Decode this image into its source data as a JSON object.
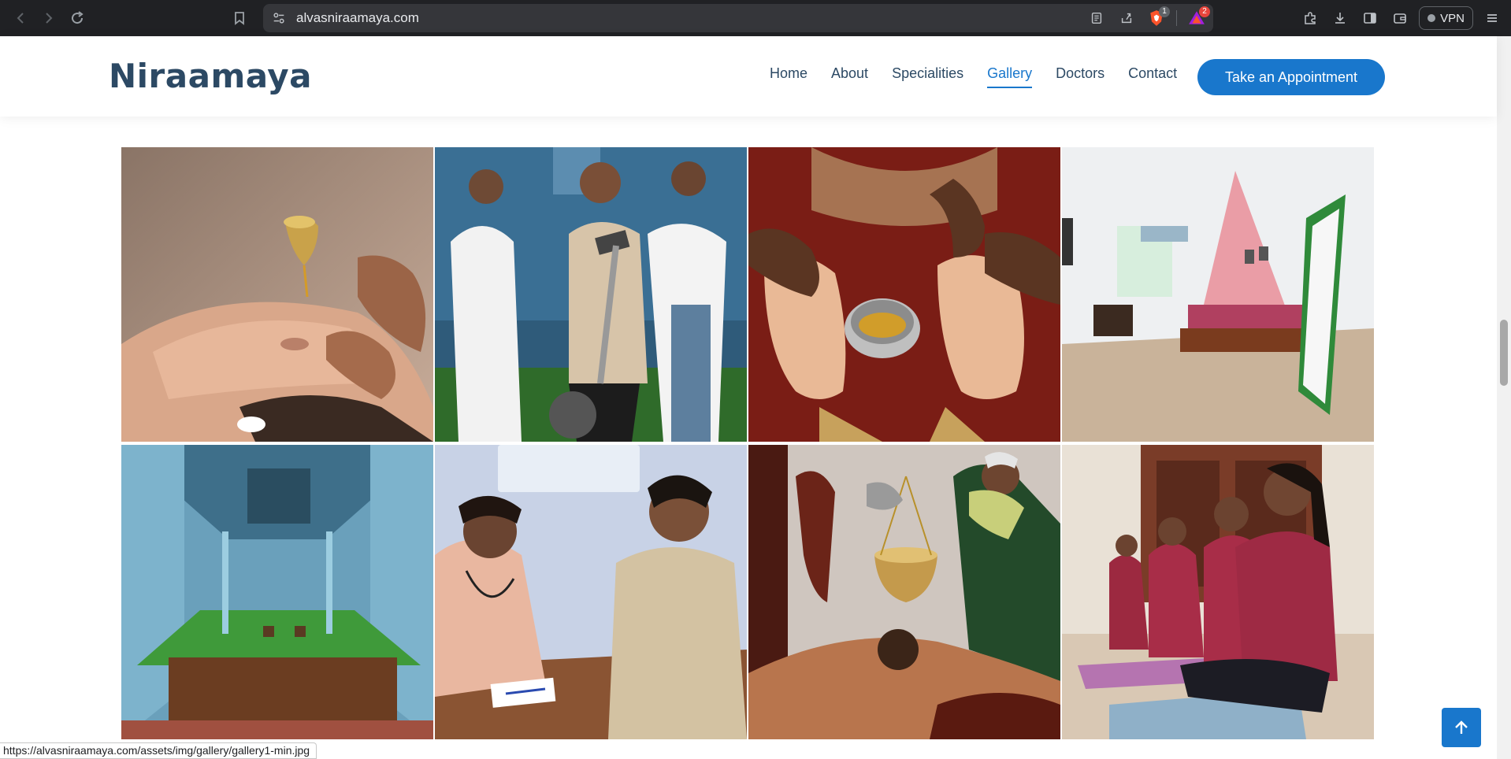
{
  "browser": {
    "url": "alvasniraamaya.com",
    "extension_badge_1": "1",
    "extension_badge_2": "2",
    "vpn_label": "VPN",
    "status_url": "https://alvasniraamaya.com/assets/img/gallery/gallery1-min.jpg"
  },
  "site": {
    "logo": "Niraamaya",
    "nav": [
      {
        "label": "Home"
      },
      {
        "label": "About"
      },
      {
        "label": "Specialities"
      },
      {
        "label": "Gallery",
        "active": true
      },
      {
        "label": "Doctors"
      },
      {
        "label": "Contact"
      }
    ],
    "cta_label": "Take an Appointment",
    "accent_color": "#1977cc",
    "heading_color": "#2c4964"
  },
  "gallery": {
    "images": [
      {
        "icon": "nasya-therapy-photo"
      },
      {
        "icon": "physiotherapy-cycle-photo"
      },
      {
        "icon": "foot-massage-photo"
      },
      {
        "icon": "patient-room-photo"
      },
      {
        "icon": "courtyard-corridor-photo"
      },
      {
        "icon": "doctor-consultation-photo"
      },
      {
        "icon": "shirodhara-therapy-photo"
      },
      {
        "icon": "yoga-session-photo"
      }
    ]
  }
}
